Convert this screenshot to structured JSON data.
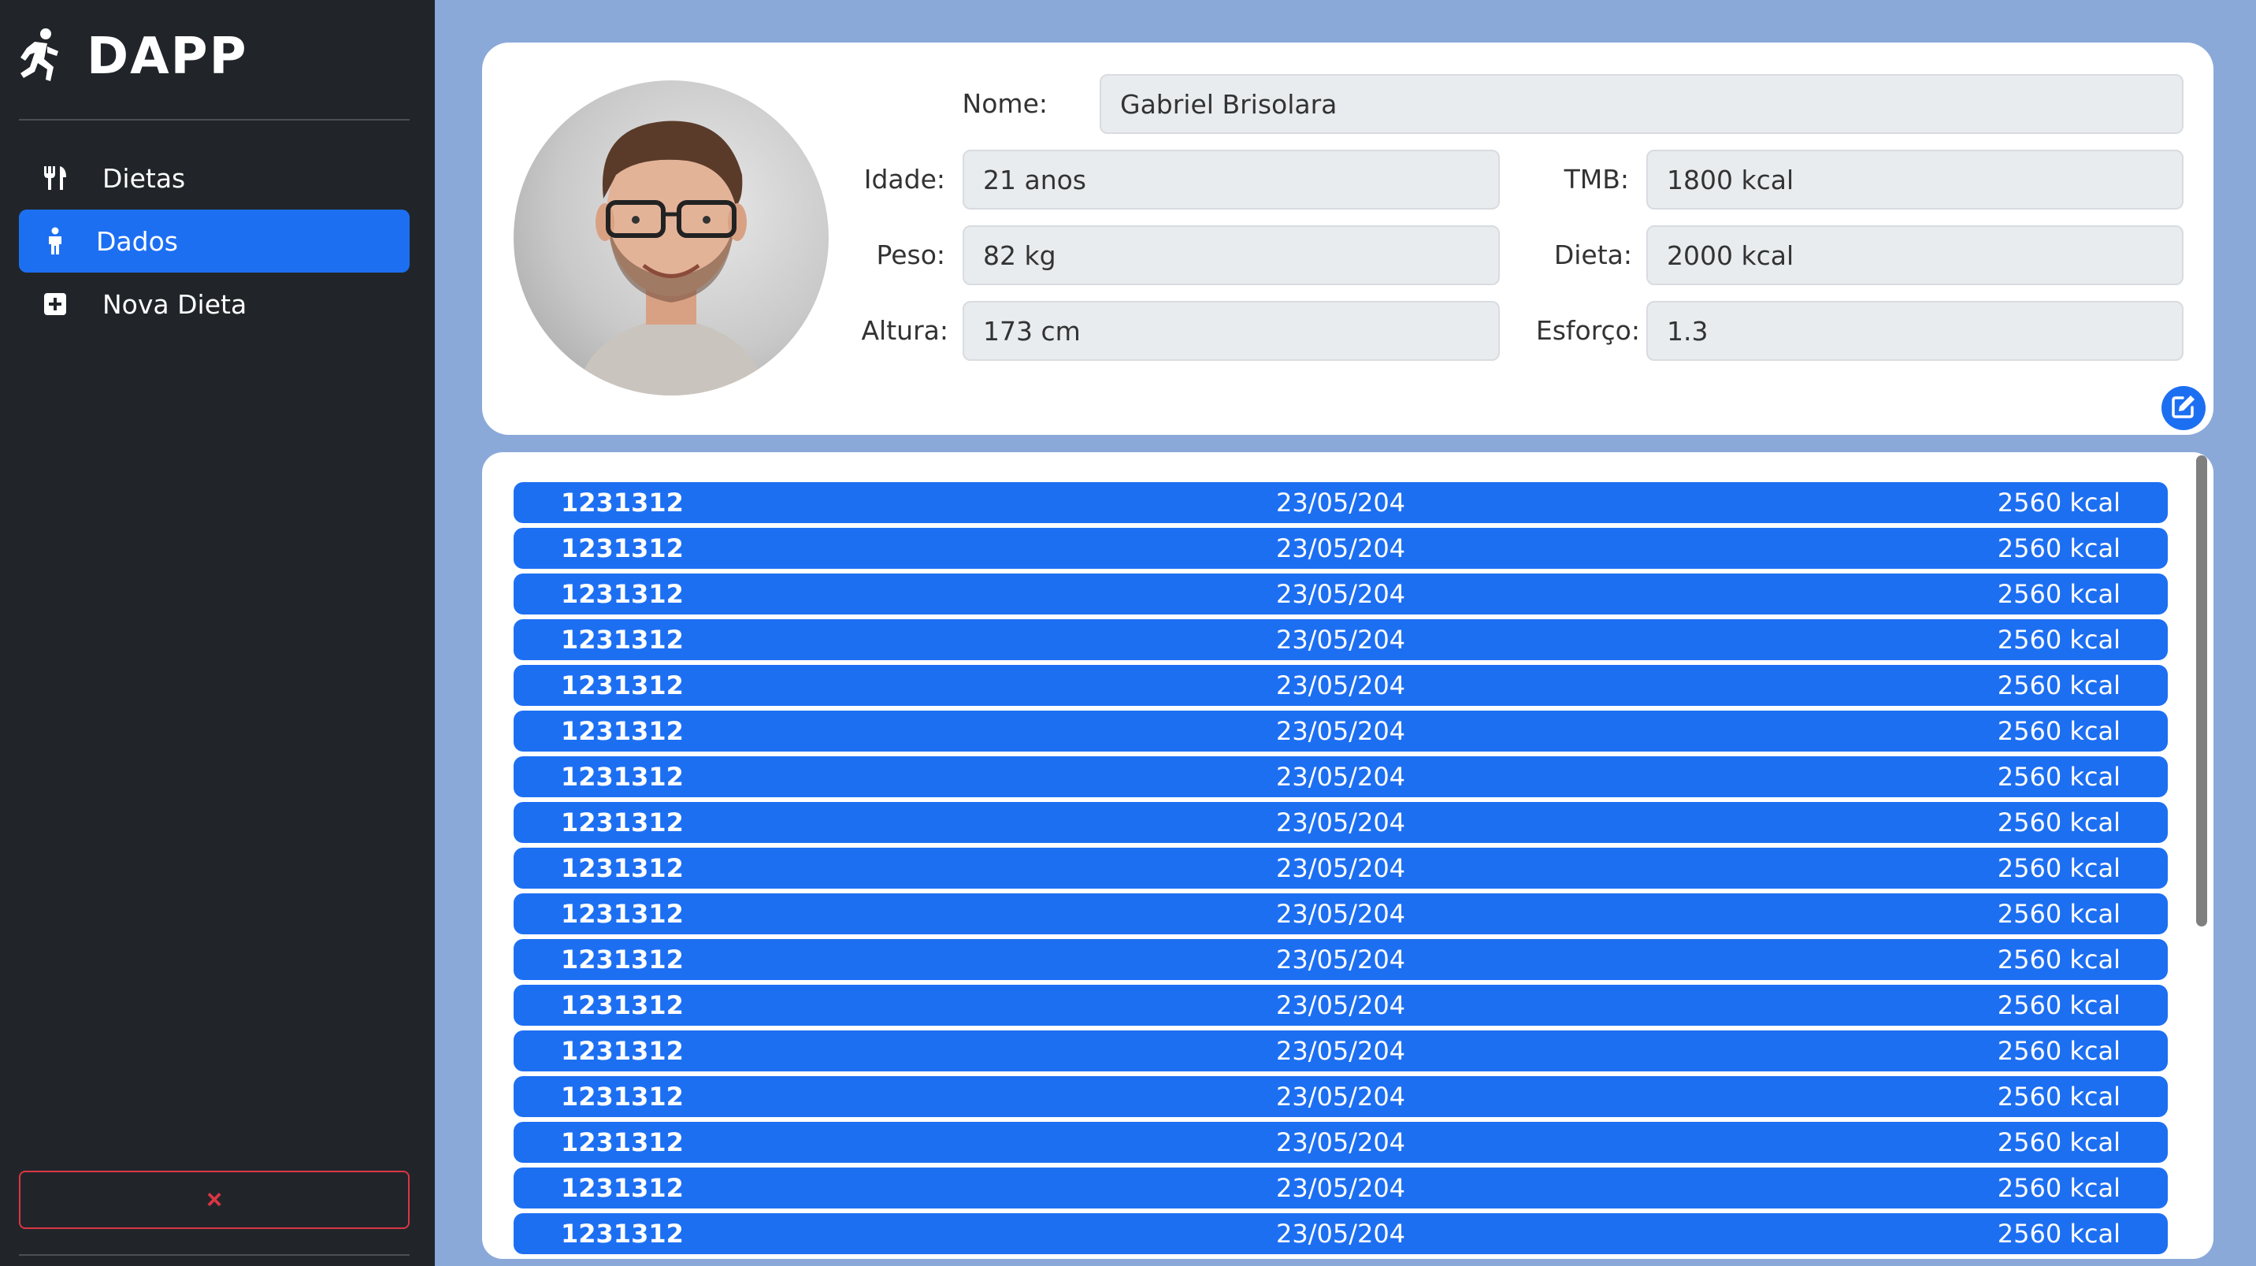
{
  "app": {
    "title": "DAPP"
  },
  "sidebar": {
    "items": [
      {
        "label": "Dietas",
        "icon": "utensils-icon",
        "active": false
      },
      {
        "label": "Dados",
        "icon": "person-icon",
        "active": true
      },
      {
        "label": "Nova Dieta",
        "icon": "plus-square-icon",
        "active": false
      }
    ],
    "logout_label": "×"
  },
  "profile": {
    "fields": {
      "nome": {
        "label": "Nome:",
        "value": "Gabriel Brisolara"
      },
      "idade": {
        "label": "Idade:",
        "value": "21 anos"
      },
      "tmb": {
        "label": "TMB:",
        "value": "1800 kcal"
      },
      "peso": {
        "label": "Peso:",
        "value": "82 kg"
      },
      "dieta": {
        "label": "Dieta:",
        "value": "2000 kcal"
      },
      "altura": {
        "label": "Altura:",
        "value": "173 cm"
      },
      "esforco": {
        "label": "Esforço:",
        "value": "1.3"
      }
    }
  },
  "diets": [
    {
      "id": "1231312",
      "date": "23/05/204",
      "kcal": "2560 kcal"
    },
    {
      "id": "1231312",
      "date": "23/05/204",
      "kcal": "2560 kcal"
    },
    {
      "id": "1231312",
      "date": "23/05/204",
      "kcal": "2560 kcal"
    },
    {
      "id": "1231312",
      "date": "23/05/204",
      "kcal": "2560 kcal"
    },
    {
      "id": "1231312",
      "date": "23/05/204",
      "kcal": "2560 kcal"
    },
    {
      "id": "1231312",
      "date": "23/05/204",
      "kcal": "2560 kcal"
    },
    {
      "id": "1231312",
      "date": "23/05/204",
      "kcal": "2560 kcal"
    },
    {
      "id": "1231312",
      "date": "23/05/204",
      "kcal": "2560 kcal"
    },
    {
      "id": "1231312",
      "date": "23/05/204",
      "kcal": "2560 kcal"
    },
    {
      "id": "1231312",
      "date": "23/05/204",
      "kcal": "2560 kcal"
    },
    {
      "id": "1231312",
      "date": "23/05/204",
      "kcal": "2560 kcal"
    },
    {
      "id": "1231312",
      "date": "23/05/204",
      "kcal": "2560 kcal"
    },
    {
      "id": "1231312",
      "date": "23/05/204",
      "kcal": "2560 kcal"
    },
    {
      "id": "1231312",
      "date": "23/05/204",
      "kcal": "2560 kcal"
    },
    {
      "id": "1231312",
      "date": "23/05/204",
      "kcal": "2560 kcal"
    },
    {
      "id": "1231312",
      "date": "23/05/204",
      "kcal": "2560 kcal"
    },
    {
      "id": "1231312",
      "date": "23/05/204",
      "kcal": "2560 kcal"
    }
  ],
  "colors": {
    "accent": "#1d6ff2",
    "sidebar_bg": "#212529",
    "page_bg": "#8aa9d9",
    "danger": "#dc3545"
  }
}
